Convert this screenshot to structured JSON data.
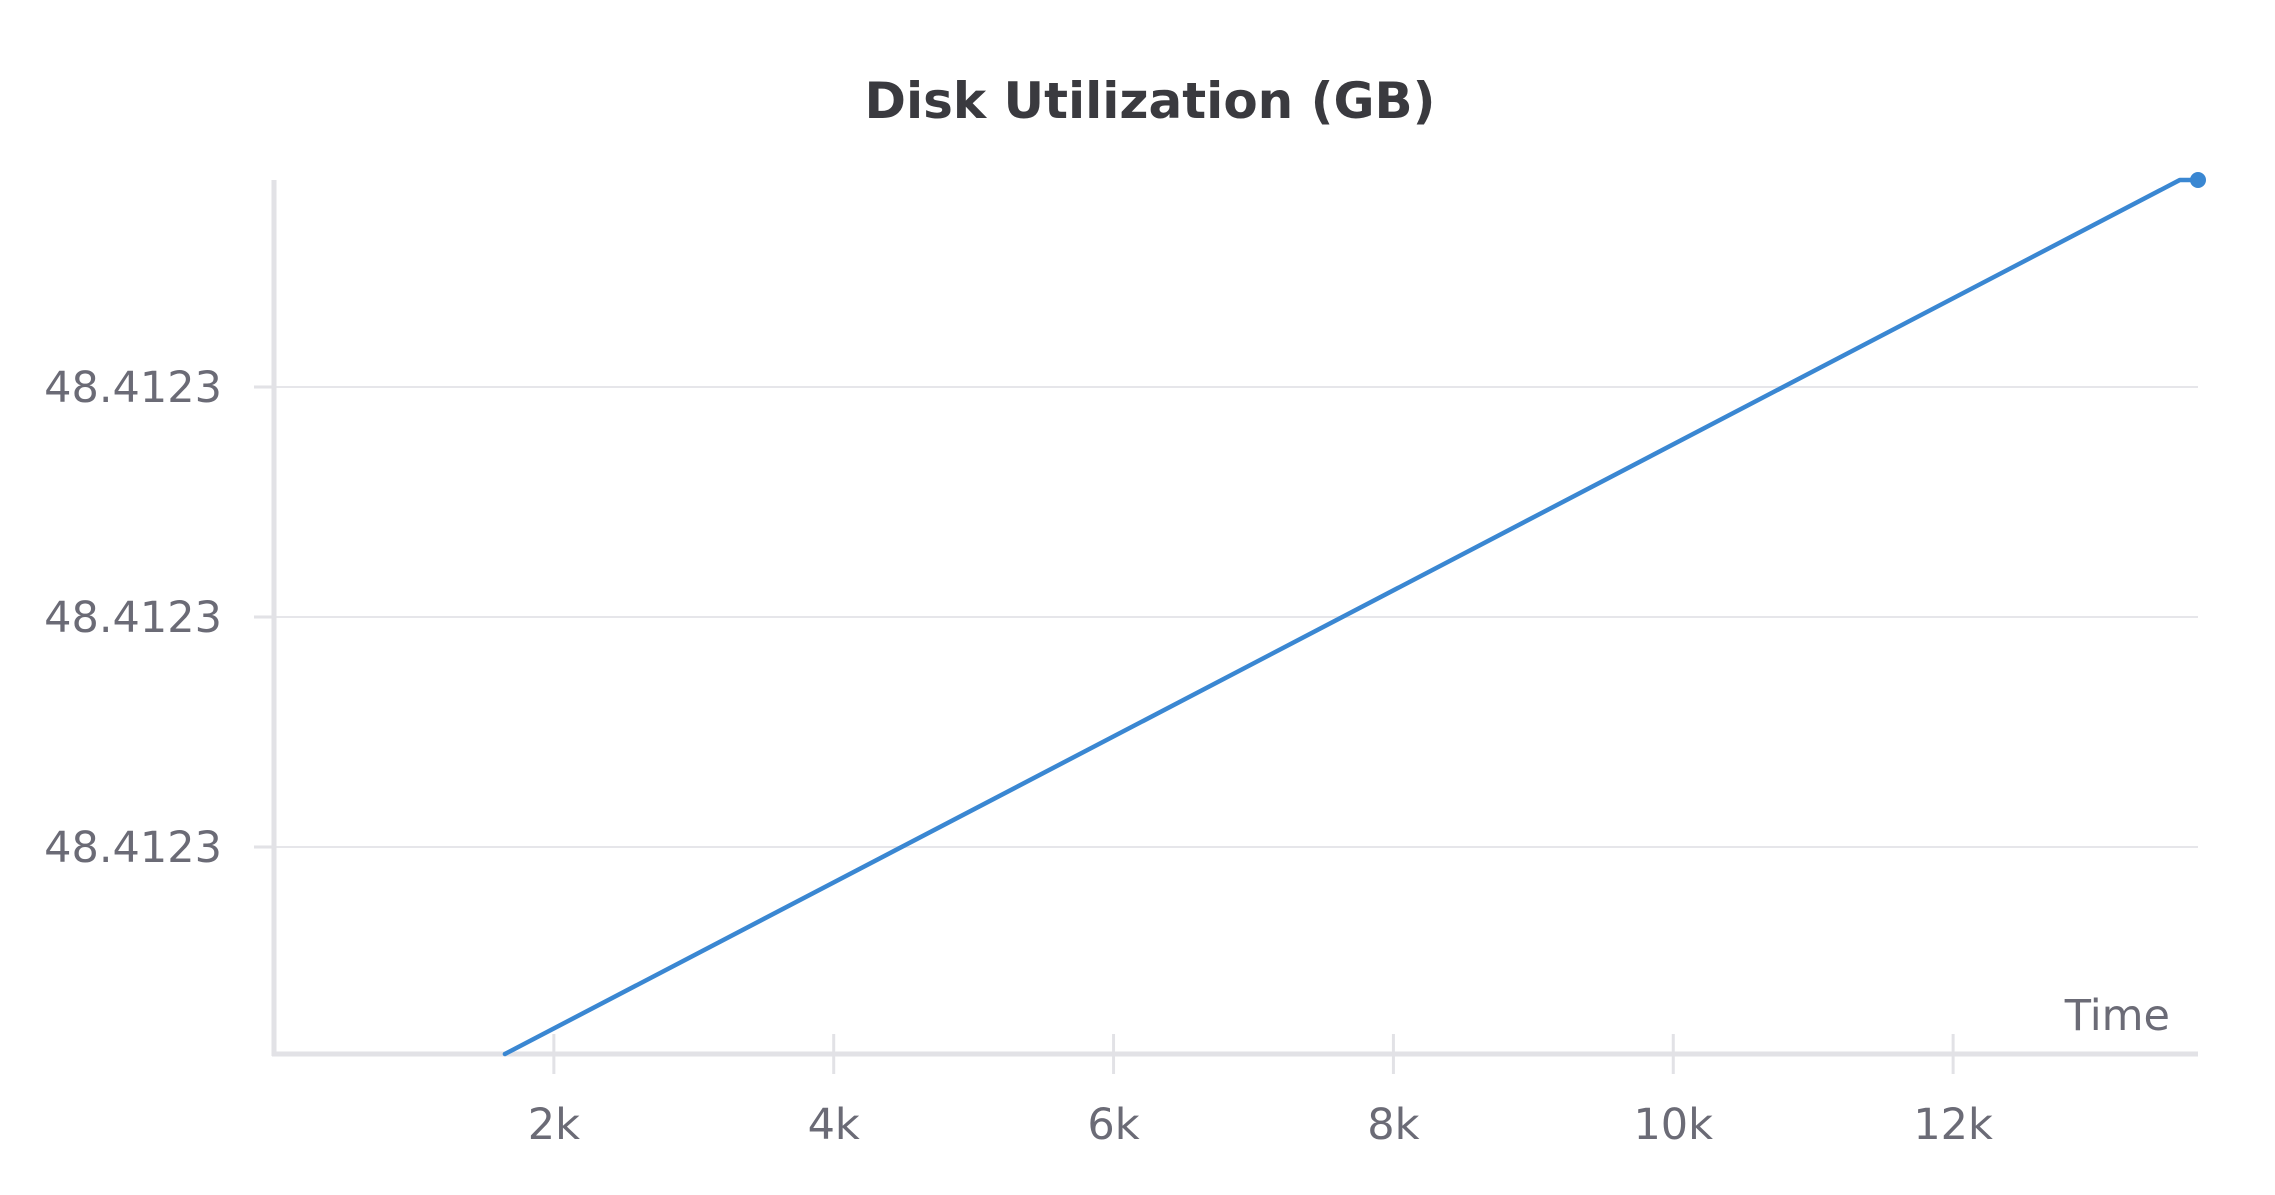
{
  "chart_data": {
    "type": "line",
    "title": "Disk Utilization (GB)",
    "xlabel": "Time",
    "ylabel": "",
    "x_ticks": [
      {
        "value": 2000,
        "label": "2k"
      },
      {
        "value": 4000,
        "label": "4k"
      },
      {
        "value": 6000,
        "label": "6k"
      },
      {
        "value": 8000,
        "label": "8k"
      },
      {
        "value": 10000,
        "label": "10k"
      },
      {
        "value": 12000,
        "label": "12k"
      }
    ],
    "y_ticks": [
      {
        "value": 48.41231,
        "label": "48.4123"
      },
      {
        "value": 48.41232,
        "label": "48.4123"
      },
      {
        "value": 48.41233,
        "label": "48.4123"
      }
    ],
    "xlim": [
      0,
      13750
    ],
    "ylim": [
      48.412301,
      48.412339
    ],
    "grid": true,
    "legend": "none",
    "series": [
      {
        "color": "#3a87d2",
        "x": [
          1650,
          13620,
          13750
        ],
        "y": [
          48.412301,
          48.412339,
          48.412339
        ],
        "end_marker": true
      }
    ],
    "colors": {
      "line": "#3a87d2",
      "grid": "#e6e6ea",
      "axis": "#e2e2e6",
      "text": "#6b6b76",
      "title": "#3a3a3f"
    }
  }
}
